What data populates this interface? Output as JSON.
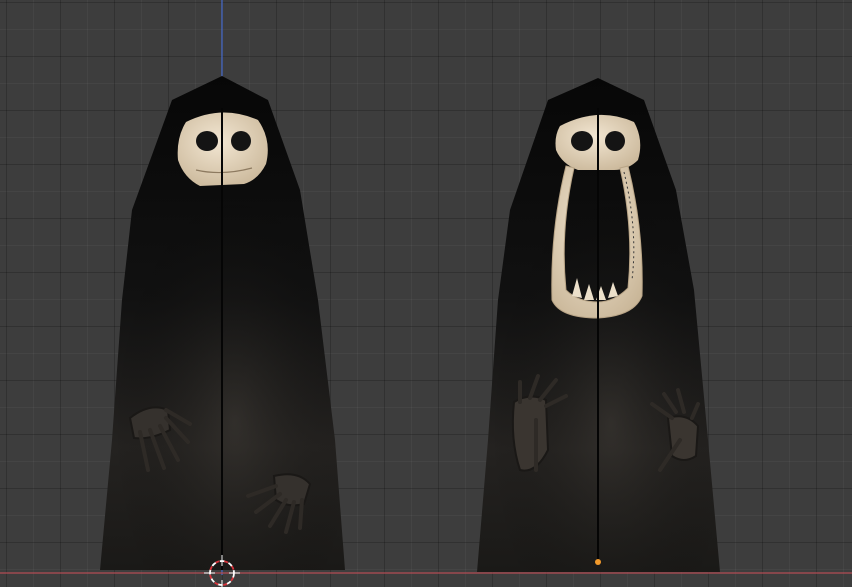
{
  "viewport": {
    "mode": "3D viewport",
    "axis_colors": {
      "x_axis": "#b34b54",
      "z_axis": "#4a6fd0"
    },
    "icons": [
      "3d-cursor-icon",
      "object-origin-icon"
    ]
  },
  "scene": {
    "objects": [
      {
        "name": "cloaked-ghost-closed-mouth",
        "colors": {
          "cloak": "#0d0d0d",
          "skull": "#e6d6be",
          "hands": "#3a3530"
        }
      },
      {
        "name": "cloaked-ghost-open-mouth",
        "colors": {
          "cloak": "#0d0d0d",
          "skull": "#e6d6be",
          "hands": "#3a3530"
        }
      }
    ],
    "origin_color": "#f39a2b"
  }
}
